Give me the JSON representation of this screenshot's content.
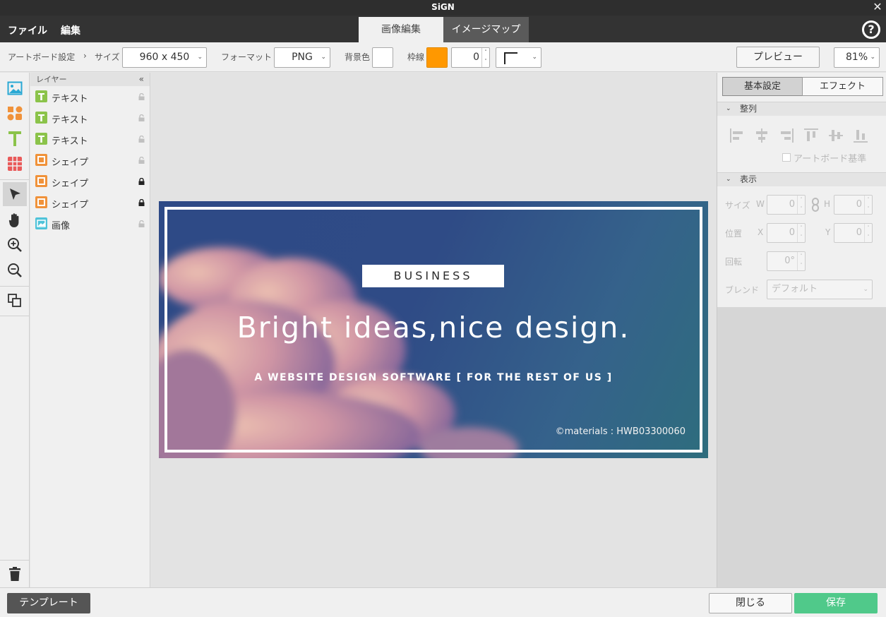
{
  "app": {
    "title": "SiGN"
  },
  "menu": {
    "file": "ファイル",
    "edit": "編集"
  },
  "tabs": {
    "image_edit": "画像編集",
    "image_map": "イメージマップ"
  },
  "toolbar": {
    "artboard_settings": "アートボード設定",
    "size_label": "サイズ",
    "size_value": "960 x 450",
    "format_label": "フォーマット",
    "format_value": "PNG",
    "bg_label": "背景色",
    "bg_color": "#ffffff",
    "border_label": "枠線",
    "border_color": "#ff9800",
    "border_width": "0",
    "preview": "プレビュー",
    "zoom": "81%"
  },
  "layers": {
    "header": "レイヤー",
    "items": [
      {
        "name": "テキスト",
        "type": "text",
        "locked": false
      },
      {
        "name": "テキスト",
        "type": "text",
        "locked": false
      },
      {
        "name": "テキスト",
        "type": "text",
        "locked": false
      },
      {
        "name": "シェイプ",
        "type": "shape",
        "locked": false
      },
      {
        "name": "シェイプ",
        "type": "shape",
        "locked": true
      },
      {
        "name": "シェイプ",
        "type": "shape",
        "locked": true
      },
      {
        "name": "画像",
        "type": "image",
        "locked": false
      }
    ]
  },
  "artboard": {
    "badge": "BUSINESS",
    "headline": "Bright ideas,nice design.",
    "subline": "A WEBSITE DESIGN SOFTWARE [ FOR THE REST OF US ]",
    "credit": "©materials : HWB03300060"
  },
  "right_panel": {
    "tab_basic": "基本設定",
    "tab_effect": "エフェクト",
    "section_align": "整列",
    "artboard_basis": "アートボード基準",
    "section_display": "表示",
    "size_label": "サイズ",
    "w_label": "W",
    "w_value": "0",
    "h_label": "H",
    "h_value": "0",
    "position_label": "位置",
    "x_label": "X",
    "x_value": "0",
    "y_label": "Y",
    "y_value": "0",
    "rotation_label": "回転",
    "rotation_value": "0°",
    "blend_label": "ブレンド",
    "blend_value": "デフォルト"
  },
  "bottom": {
    "template": "テンプレート",
    "close": "閉じる",
    "save": "保存"
  },
  "colors": {
    "accent_green": "#50c98a",
    "text_icon": "#8bc34a",
    "shape_icon": "#f0923a",
    "image_icon": "#4fc3d9"
  }
}
